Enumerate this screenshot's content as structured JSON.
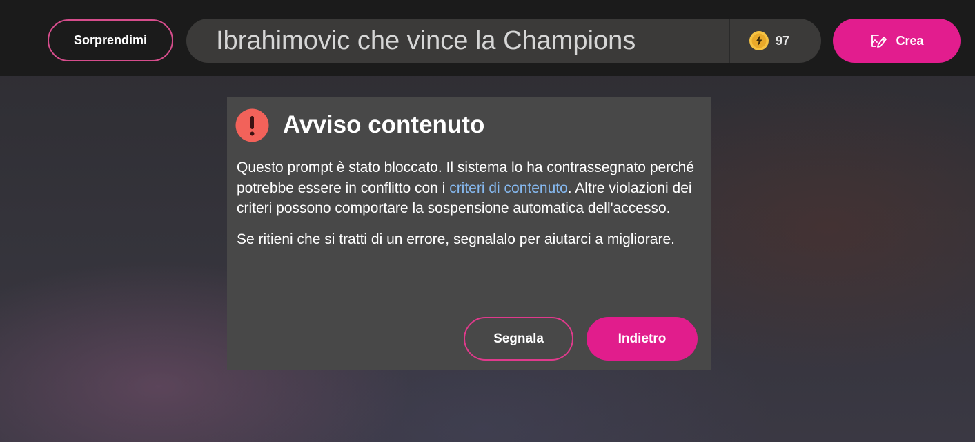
{
  "header": {
    "surprise_label": "Sorprendimi",
    "prompt_value": "Ibrahimovic che vince la Champions",
    "coin_count": "97",
    "coin_icon": "coin-icon",
    "create_label": "Crea",
    "create_icon": "image-edit-icon"
  },
  "dialog": {
    "icon": "exclamation-icon",
    "title": "Avviso contenuto",
    "paragraph1_before": "Questo prompt è stato bloccato. Il sistema lo ha contrassegnato perché potrebbe essere in conflitto con i ",
    "paragraph1_link": "criteri di contenuto",
    "paragraph1_after": ". Altre violazioni dei criteri possono comportare la sospensione automatica dell'accesso.",
    "paragraph2": "Se ritieni che si tratti di un errore, segnalalo per aiutarci a migliorare.",
    "report_label": "Segnala",
    "back_label": "Indietro"
  },
  "colors": {
    "accent": "#e21d8e",
    "accent_border": "#d64d8c",
    "link": "#86b9f0",
    "warning": "#f2625a",
    "dialog_bg": "#484848",
    "topbar_bg": "#1b1b1b",
    "coin": "#f5c242"
  }
}
